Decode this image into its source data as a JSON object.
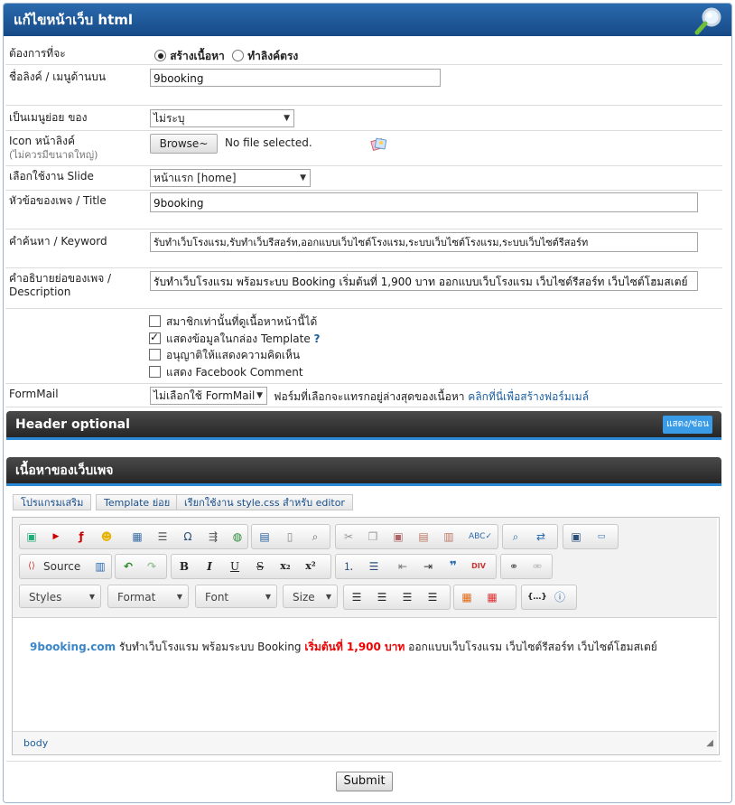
{
  "window": {
    "title": "แก้ไขหน้าเว็บ html"
  },
  "form": {
    "action": {
      "label": "ต้องการที่จะ",
      "option1": "สร้างเนื้อหา",
      "option2": "ทำลิงค์ตรง"
    },
    "link_name": {
      "label": "ชื่อลิงค์ / เมนูด้านบน",
      "value": "9booking"
    },
    "submenu_of": {
      "label": "เป็นเมนูย่อย ของ",
      "value": "ไม่ระบุ"
    },
    "icon": {
      "label": "Icon หน้าลิงค์",
      "note": "(ไม่ควรมีขนาดใหญ่)",
      "browse": "Browse~",
      "file_status": "No file selected."
    },
    "slide": {
      "label": "เลือกใช้งาน Slide",
      "value": "หน้าแรก [home]"
    },
    "title": {
      "label": "หัวข้อของเพจ / Title",
      "value": "9booking"
    },
    "keyword": {
      "label": "คำค้นหา / Keyword",
      "value": "รับทำเว็บโรงแรม,รับทำเว็บรีสอร์ท,ออกแบบเว็บไซต์โรงแรม,ระบบเว็บไซต์โรงแรม,ระบบเว็บไซต์รีสอร์ท"
    },
    "description": {
      "label": "คำอธิบายย่อของเพจ /",
      "label2": "Description",
      "value": "รับทำเว็บโรงแรม พร้อมระบบ Booking เริ่มต้นที่ 1,900 บาท ออกแบบเว็บโรงแรม เว็บไซต์รีสอร์ท เว็บไซต์โฮมสเตย์"
    },
    "options": [
      {
        "label": "สมาชิกเท่านั้นที่ดูเนื้อหาหน้านี้ได้",
        "checked": false
      },
      {
        "label": "แสดงข้อมูลในกล่อง Template",
        "checked": true,
        "help": "?"
      },
      {
        "label": "อนุญาติให้แสดงความคิดเห็น",
        "checked": false
      },
      {
        "label": "แสดง Facebook Comment",
        "checked": false
      }
    ],
    "formmail": {
      "label": "FormMail",
      "value": "ไม่เลือกใช้ FormMail",
      "hint": "ฟอร์มที่เลือกจะแทรกอยู่ล่างสุดของเนื้อหา",
      "link": "คลิกที่นี่เพื่อสร้างฟอร์มเมล์"
    }
  },
  "header_optional": {
    "title": "Header optional",
    "toggle": "แสดง/ซ่อน"
  },
  "content_section": {
    "title": "เนื้อหาของเว็บเพจ"
  },
  "tabs": [
    "โปรแกรมเสริม",
    "Template ย่อย",
    "เรียกใช้งาน style.css สำหรับ editor"
  ],
  "editor": {
    "source_label": "Source",
    "combos": [
      "Styles",
      "Format",
      "Font",
      "Size"
    ],
    "body": {
      "brand": "9booking.com",
      "text1": " รับทำเว็บโรงแรม พร้อมระบบ Booking ",
      "highlight": "เริ่มต้นที่ 1,900 บาท",
      "text2": " ออกแบบเว็บโรงแรม เว็บไซต์รีสอร์ท เว็บไซต์โฮมสเตย์"
    },
    "status_path": "body"
  },
  "submit": "Submit"
}
